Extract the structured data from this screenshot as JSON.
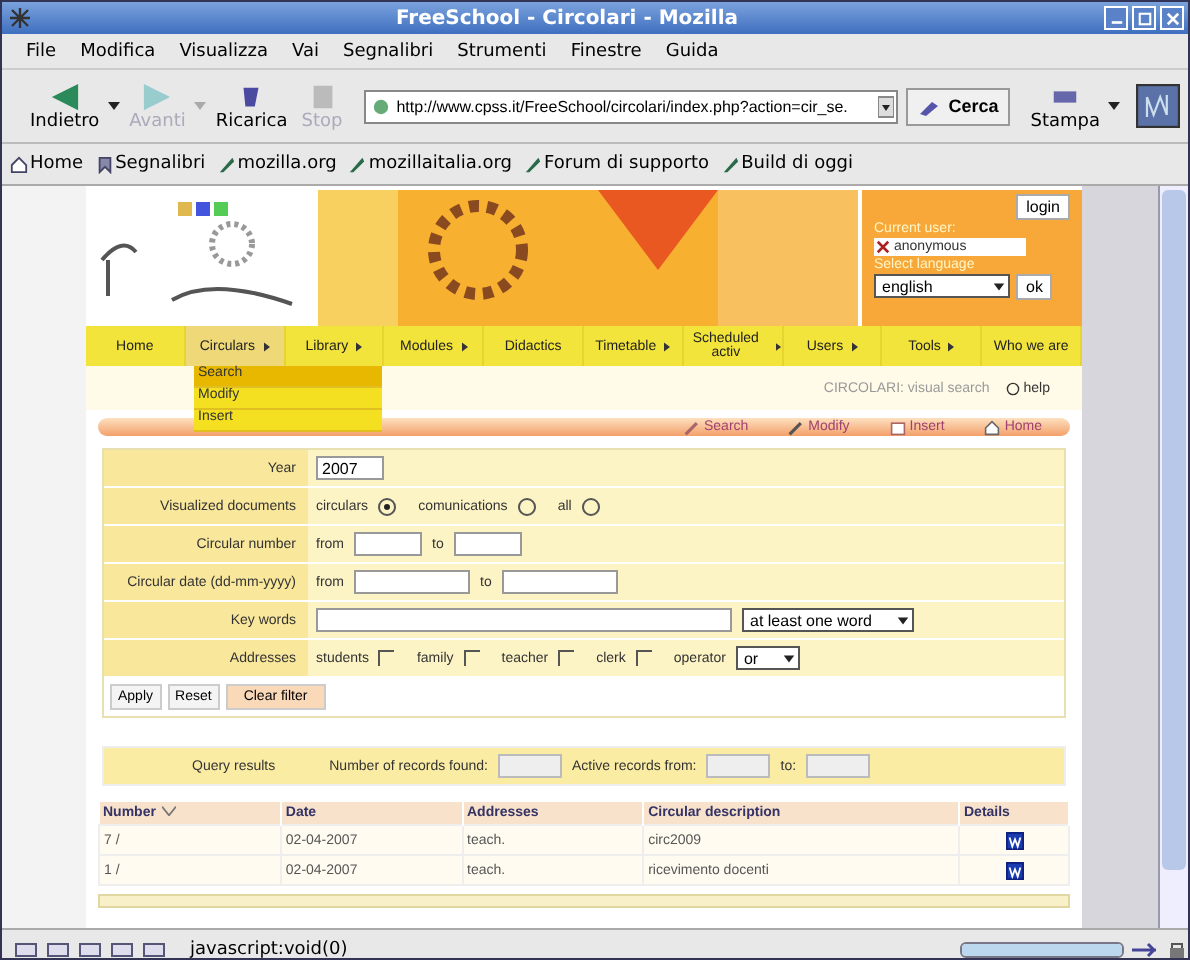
{
  "window": {
    "title": "FreeSchool - Circolari - Mozilla"
  },
  "menu": [
    "File",
    "Modifica",
    "Visualizza",
    "Vai",
    "Segnalibri",
    "Strumenti",
    "Finestre",
    "Guida"
  ],
  "toolbar": {
    "buttons": [
      {
        "label": "Indietro",
        "kind": "back",
        "disabled": false
      },
      {
        "label": "Avanti",
        "kind": "forward",
        "disabled": true
      },
      {
        "label": "Ricarica",
        "kind": "reload",
        "disabled": false
      },
      {
        "label": "Stop",
        "kind": "stop",
        "disabled": true
      }
    ],
    "url": "http://www.cpss.it/FreeSchool/circolari/index.php?action=cir_se.",
    "search_button": "Cerca",
    "print_button": "Stampa"
  },
  "bookmarks": [
    {
      "label": "Home",
      "kind": "home"
    },
    {
      "label": "Segnalibri",
      "kind": "bookmarks"
    },
    {
      "label": "mozilla.org",
      "kind": "link"
    },
    {
      "label": "mozillaitalia.org",
      "kind": "link"
    },
    {
      "label": "Forum di supporto",
      "kind": "link"
    },
    {
      "label": "Build di oggi",
      "kind": "link"
    }
  ],
  "site": {
    "login": {
      "button": "login",
      "current_user_label": "Current user:",
      "user": "anonymous",
      "language_label": "Select language",
      "language": "english",
      "ok": "ok"
    },
    "nav": [
      {
        "label": "Home",
        "submenu": false,
        "selected": false
      },
      {
        "label": "Circulars",
        "submenu": true,
        "selected": true
      },
      {
        "label": "Library",
        "submenu": true,
        "selected": false
      },
      {
        "label": "Modules",
        "submenu": true,
        "selected": false
      },
      {
        "label": "Didactics",
        "submenu": false,
        "selected": false
      },
      {
        "label": "Timetable",
        "submenu": true,
        "selected": false
      },
      {
        "label": "Scheduled activ",
        "submenu": true,
        "selected": false
      },
      {
        "label": "Users",
        "submenu": true,
        "selected": false
      },
      {
        "label": "Tools",
        "submenu": true,
        "selected": false
      },
      {
        "label": "Who we are",
        "submenu": false,
        "selected": false
      }
    ],
    "dropdown": [
      {
        "label": "Search",
        "selected": true
      },
      {
        "label": "Modify",
        "selected": false
      },
      {
        "label": "Insert",
        "selected": false
      }
    ],
    "breadcrumb": "CIRCOLARI: visual search",
    "help": "help",
    "actions": [
      {
        "label": "Search",
        "kind": "search"
      },
      {
        "label": "Modify",
        "kind": "modify"
      },
      {
        "label": "Insert",
        "kind": "insert"
      },
      {
        "label": "Home",
        "kind": "home"
      }
    ],
    "form": {
      "rows": [
        {
          "kind": "text",
          "label": "Year",
          "value": "2007"
        },
        {
          "kind": "radio",
          "label": "Visualized documents",
          "options": [
            {
              "label": "circulars",
              "selected": true
            },
            {
              "label": "comunications",
              "selected": false
            },
            {
              "label": "all",
              "selected": false
            }
          ]
        },
        {
          "kind": "range",
          "label": "Circular number",
          "from": "from",
          "to": "to",
          "wide": false
        },
        {
          "kind": "range",
          "label": "Circular date (dd-mm-yyyy)",
          "from": "from",
          "to": "to",
          "wide": true
        },
        {
          "kind": "keywords",
          "label": "Key words",
          "select": "at least one word"
        },
        {
          "kind": "checks",
          "label": "Addresses",
          "options": [
            {
              "label": "students",
              "checked": false
            },
            {
              "label": "family",
              "checked": false
            },
            {
              "label": "teacher",
              "checked": false
            },
            {
              "label": "clerk",
              "checked": false
            }
          ],
          "operator_label": "operator",
          "operator": "or"
        }
      ],
      "buttons": [
        "Apply",
        "Reset",
        "Clear filter"
      ]
    },
    "query": {
      "label": "Query results",
      "found_label": "Number of records found:",
      "active_label": "Active records from:",
      "to_label": "to:"
    },
    "table": {
      "columns": [
        "Number",
        "Date",
        "Addresses",
        "Circular description",
        "Details"
      ],
      "rows": [
        {
          "cells": [
            "7 /",
            "02-04-2007",
            "teach.",
            "circ2009"
          ]
        },
        {
          "cells": [
            "1 /",
            "02-04-2007",
            "teach.",
            "ricevimento docenti"
          ]
        }
      ]
    }
  },
  "status_bar": {
    "text": "javascript:void(0)",
    "progress": {
      "level": 1
    }
  }
}
